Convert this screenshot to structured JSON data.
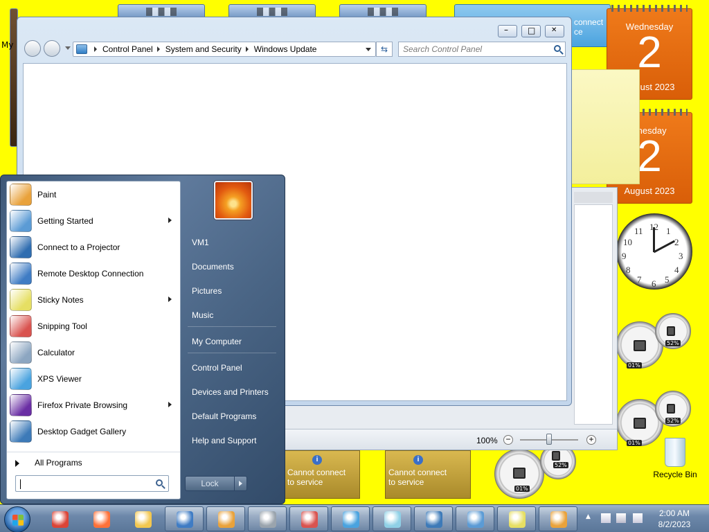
{
  "desktop": {
    "my_computer_label": "My C",
    "calendar1": {
      "dow": "Wednesday",
      "day": "2",
      "month_year": "August 2023"
    },
    "calendar2": {
      "dow": "dnesday",
      "day": "2",
      "month_year": "August 2023"
    },
    "feed_tile_top": {
      "line1": "connect",
      "line2": "ce"
    },
    "feed_tiles": [
      {
        "line1": "Cannot connect",
        "line2": "to service"
      },
      {
        "line1": "Cannot connect",
        "line2": "to service"
      }
    ],
    "clock_numbers": [
      "12",
      "1",
      "2",
      "3",
      "4",
      "5",
      "6",
      "7",
      "8",
      "9",
      "10",
      "11"
    ],
    "cpu_meters": [
      {
        "cpu": "01%",
        "mem": "52%"
      },
      {
        "cpu": "01%",
        "mem": "52%"
      },
      {
        "cpu": "01%",
        "mem": "52%"
      }
    ],
    "recycle_bin_label": "Recycle Bin"
  },
  "explorer": {
    "breadcrumb": [
      "Control Panel",
      "System and Security",
      "Windows Update"
    ],
    "search_placeholder": "Search Control Panel",
    "refresh_symbol": "⇆",
    "minimize_symbol": "–",
    "maximize_symbol": "□",
    "close_symbol": "✕"
  },
  "doc_window": {
    "zoom_text": "100%",
    "zoom_minus": "−",
    "zoom_plus": "+"
  },
  "start_menu": {
    "programs": [
      {
        "label": "Paint",
        "icon": "paint-icon",
        "has_submenu": false,
        "color": "#e9a23b"
      },
      {
        "label": "Getting Started",
        "icon": "getting-started-icon",
        "has_submenu": true,
        "color": "#5b9bd5"
      },
      {
        "label": "Connect to a Projector",
        "icon": "projector-icon",
        "has_submenu": false,
        "color": "#2f6db0"
      },
      {
        "label": "Remote Desktop Connection",
        "icon": "remote-desktop-icon",
        "has_submenu": false,
        "color": "#3f7cc4"
      },
      {
        "label": "Sticky Notes",
        "icon": "sticky-notes-icon",
        "has_submenu": true,
        "color": "#e6df63"
      },
      {
        "label": "Snipping Tool",
        "icon": "snipping-tool-icon",
        "has_submenu": false,
        "color": "#d9534f"
      },
      {
        "label": "Calculator",
        "icon": "calculator-icon",
        "has_submenu": false,
        "color": "#8ca6c1"
      },
      {
        "label": "XPS Viewer",
        "icon": "xps-viewer-icon",
        "has_submenu": false,
        "color": "#4aa3df"
      },
      {
        "label": "Firefox Private Browsing",
        "icon": "firefox-private-icon",
        "has_submenu": true,
        "color": "#6a2ea4"
      },
      {
        "label": "Desktop Gadget Gallery",
        "icon": "gadget-gallery-icon",
        "has_submenu": false,
        "color": "#3d7ab8"
      }
    ],
    "all_programs_label": "All Programs",
    "search_value": "",
    "right_items": [
      {
        "label": "VM1",
        "name": "start-right-vm1"
      },
      {
        "label": "Documents",
        "name": "start-right-documents"
      },
      {
        "label": "Pictures",
        "name": "start-right-pictures"
      },
      {
        "label": "Music",
        "name": "start-right-music"
      },
      {
        "label": "My Computer",
        "name": "start-right-my-computer"
      },
      {
        "label": "Control Panel",
        "name": "start-right-control-panel"
      },
      {
        "label": "Devices and Printers",
        "name": "start-right-devices-printers"
      },
      {
        "label": "Default Programs",
        "name": "start-right-default-programs"
      },
      {
        "label": "Help and Support",
        "name": "start-right-help-support"
      }
    ],
    "lock_label": "Lock"
  },
  "taskbar": {
    "items": [
      {
        "name": "taskbar-chrome",
        "icon": "chrome-icon",
        "active": false,
        "color": "#db4437"
      },
      {
        "name": "taskbar-firefox",
        "icon": "firefox-icon",
        "active": false,
        "color": "#ff7139"
      },
      {
        "name": "taskbar-explorer",
        "icon": "folder-icon",
        "active": false,
        "color": "#f3c74f"
      },
      {
        "name": "taskbar-remote-desktop",
        "icon": "remote-desktop-icon",
        "active": true,
        "color": "#3f7cc4"
      },
      {
        "name": "taskbar-calculator",
        "icon": "calculator-icon",
        "active": true,
        "color": "#e9a23b"
      },
      {
        "name": "taskbar-fax-scan",
        "icon": "fax-icon",
        "active": true,
        "color": "#9aa4ad"
      },
      {
        "name": "taskbar-snipping-tool",
        "icon": "snipping-tool-icon",
        "active": true,
        "color": "#d9534f"
      },
      {
        "name": "taskbar-xps-viewer",
        "icon": "xps-viewer-icon",
        "active": true,
        "color": "#4aa3df"
      },
      {
        "name": "taskbar-journal",
        "icon": "journal-icon",
        "active": true,
        "color": "#8fd0e6"
      },
      {
        "name": "taskbar-wordpad",
        "icon": "wordpad-icon",
        "active": true,
        "color": "#3d7ab8"
      },
      {
        "name": "taskbar-gadget-gallery",
        "icon": "gadget-gallery-icon",
        "active": true,
        "color": "#5b9bd5"
      },
      {
        "name": "taskbar-sticky-notes",
        "icon": "sticky-notes-icon",
        "active": true,
        "color": "#e6df63"
      },
      {
        "name": "taskbar-paint",
        "icon": "paint-icon",
        "active": true,
        "color": "#e9a23b"
      }
    ],
    "time": "2:00 AM",
    "date": "8/2/2023",
    "tray_up_arrow": "▲"
  }
}
